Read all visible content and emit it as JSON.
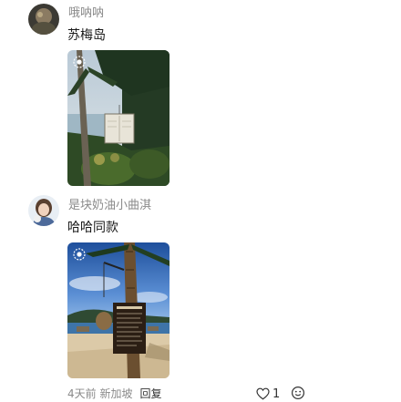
{
  "comments": [
    {
      "username": "哦呐呐",
      "text": "苏梅岛",
      "avatar_icon": "avatar-rock-photo",
      "photo_icon": "tropical-trees-sign-photo"
    },
    {
      "username": "是块奶油小曲淇",
      "text": "哈哈同款",
      "avatar_icon": "avatar-girl-photo",
      "photo_icon": "beach-palm-menu-board-photo"
    }
  ],
  "footer": {
    "time_location": "4天前 新加坡",
    "reply_label": "回复",
    "like_count": "1"
  },
  "colors": {
    "username": "#8a8a8a",
    "text": "#1a1a1a",
    "meta": "#8a8a8a"
  }
}
